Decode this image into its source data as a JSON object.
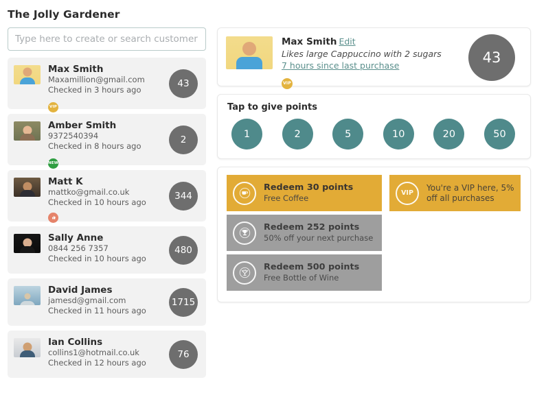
{
  "app": {
    "title": "The Jolly Gardener"
  },
  "search": {
    "placeholder": "Type here to create or search customer",
    "value": ""
  },
  "customer_list": [
    {
      "name": "Max Smith",
      "contact": "Maxamillion@gmail.com",
      "checkin": "Checked in 3 hours ago",
      "points": "43",
      "badge": "VIP",
      "badge_type": "vip",
      "avatar": "av-max"
    },
    {
      "name": "Amber Smith",
      "contact": "9372540394",
      "checkin": "Checked in 8 hours ago",
      "points": "2",
      "badge": "NEW",
      "badge_type": "new",
      "avatar": "av-amber"
    },
    {
      "name": "Matt K",
      "contact": "mattko@gmail.co.uk",
      "checkin": "Checked in 10 hours ago",
      "points": "344",
      "badge": "",
      "badge_type": "rep",
      "avatar": "av-matt"
    },
    {
      "name": "Sally Anne",
      "contact": "0844 256 7357",
      "checkin": "Checked in 10 hours ago",
      "points": "480",
      "badge": "",
      "badge_type": "none",
      "avatar": "av-sally"
    },
    {
      "name": "David James",
      "contact": "jamesd@gmail.com",
      "checkin": "Checked in 11 hours ago",
      "points": "1715",
      "badge": "",
      "badge_type": "none",
      "avatar": "av-david"
    },
    {
      "name": "Ian Collins",
      "contact": "collins1@hotmail.co.uk",
      "checkin": "Checked in 12 hours ago",
      "points": "76",
      "badge": "",
      "badge_type": "none",
      "avatar": "av-ian"
    }
  ],
  "profile": {
    "name": "Max Smith",
    "edit_label": "Edit",
    "note": "Likes large Cappuccino with 2 sugars",
    "last_purchase": "7 hours since last purchase",
    "badge": "VIP",
    "points": "43"
  },
  "give_points": {
    "title": "Tap to give points",
    "options": [
      "1",
      "2",
      "5",
      "10",
      "20",
      "50"
    ]
  },
  "rewards": [
    {
      "title": "Redeem 30 points",
      "subtitle": "Free Coffee",
      "state": "active",
      "icon": "coffee-cup-icon"
    },
    {
      "title": "Redeem 252 points",
      "subtitle": "50% off your next purchase",
      "state": "locked",
      "icon": "trophy-icon"
    },
    {
      "title": "Redeem 500 points",
      "subtitle": "Free Bottle of Wine",
      "state": "locked",
      "icon": "cocktail-glass-icon"
    }
  ],
  "vip_reward": {
    "badge": "VIP",
    "text": "You're a VIP here, 5% off all purchases"
  },
  "colors": {
    "accent_teal": "#4f8a8b",
    "gold": "#e2ab36",
    "grey_locked": "#9e9e9e",
    "points_grey": "#6e6e6e",
    "badge_vip": "#e3b33f",
    "badge_new": "#2f9e41",
    "badge_rep": "#e5836a"
  }
}
